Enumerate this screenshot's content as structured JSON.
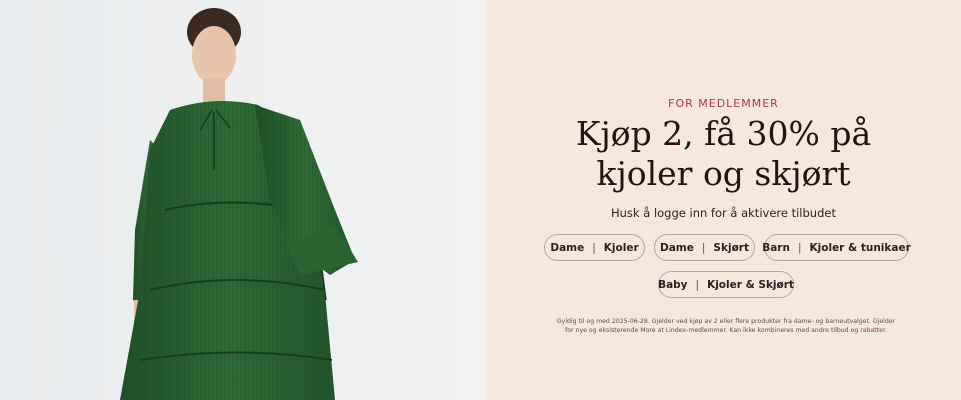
{
  "hero": {
    "image_alt": "Woman wearing a green tiered dress with ruffled sleeves"
  },
  "promo": {
    "eyebrow": "FOR MEDLEMMER",
    "headline_line1": "Kjøp 2, få 30% på",
    "headline_line2": "kjoler og skjørt",
    "subline": "Husk å logge inn for å aktivere tilbudet",
    "buttons": [
      {
        "left": "Dame",
        "right": "Kjoler"
      },
      {
        "left": "Dame",
        "right": "Skjørt"
      },
      {
        "left": "Barn",
        "right": "Kjoler & tunikaer"
      },
      {
        "left": "Baby",
        "right": "Kjoler & Skjørt"
      }
    ],
    "separator": "|",
    "fineprint_line1": "Gyldig til og med 2025-06-28. Gjelder ved kjøp av 2 eller flere produkter fra dame- og barneutvalget. Gjelder",
    "fineprint_line2": "for nye og eksisterende More at Lindex-medlemmer. Kan ikke kombineres med andre tilbud og rabatter."
  },
  "colors": {
    "image_background": "#eceff1",
    "promo_background": "#f7e8de",
    "eyebrow": "#b0344a",
    "headline": "#1f1612",
    "dress": "#2f6a36",
    "pill_border": "#b8a79f"
  }
}
